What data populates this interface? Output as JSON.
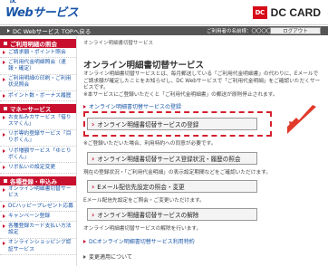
{
  "header": {
    "logo_sup": "DC",
    "logo": "Webサービス",
    "brand_mark": "DC",
    "brand": "DC CARD"
  },
  "nav": {
    "back_label": "DC Webサービス TOPへ戻る",
    "user_text": "ご利用者の名前様：〇〇〇〇様",
    "logout_label": "ログアウト"
  },
  "sidebar": {
    "sections": [
      {
        "heading": "ご利用明細の照会",
        "items": [
          "ご請求額・ポイント照会",
          "ご利用代金明細照会（速報・確定）",
          "ご利用明細の印刷・ご利用状況照会",
          "ポイント数・ボーナス履歴"
        ]
      },
      {
        "heading": "マネーサービス",
        "items": [
          "お支払みカサービス「借りスマくん」",
          "リボ専約登録サービス「目りボくん」",
          "リボ増額サービス「ゆとりボくん」",
          "リボ払いの設定変更"
        ]
      },
      {
        "heading": "各種登録・申込み",
        "items": [
          "オンライン明細書切替サービス",
          "DCハッピープレゼント応募",
          "キャンペーン登録",
          "各種登録カード支払い方法設定",
          "オンラインショッピング認証サービス"
        ]
      }
    ]
  },
  "breadcrumb": "オンライン明細書切替サービス",
  "main": {
    "title": "オンライン明細書切替サービス",
    "description": "オンライン明細書切替サービスとは、毎月郵送している「ご利用代金明細書」の代わりに、Eメールでご請求額が確定したことをお知らせし、DC Webサービスで「ご利用代金明細」をご確認いただくサービスです。",
    "description_note": "※本サービスにご登録いただくと「ご利用代金明細書」の郵送が原則停止されます。",
    "terms_link": "オンライン明細書切替サービスの登録",
    "register_button": "オンライン明細書切替サービスの登録",
    "register_note": "※ご登録いただいた場合、利用特約への同意が必要です。",
    "status_button": "オンライン明細書切替サービス登録状況・履歴の照会",
    "status_note": "現在の登録状況・「ご利用代金明細」の表示設定期間などをご確認いただけます。",
    "email_button": "Eメール配信先設定の照会・変更",
    "email_note": "Eメール配信先設定をご照会・ご変更いただけます。",
    "cancel_button": "オンライン明細書切替サービスの解除",
    "cancel_note": "オンライン明細書切替サービスの解除を行います。",
    "terms_bottom_link": "DCオンライン明細書切替サービス利用特約",
    "changes_label": "変更適用について"
  },
  "colors": {
    "brand_red": "#c8102e",
    "link_blue": "#1a56a8",
    "highlight_red": "#d5202e"
  }
}
